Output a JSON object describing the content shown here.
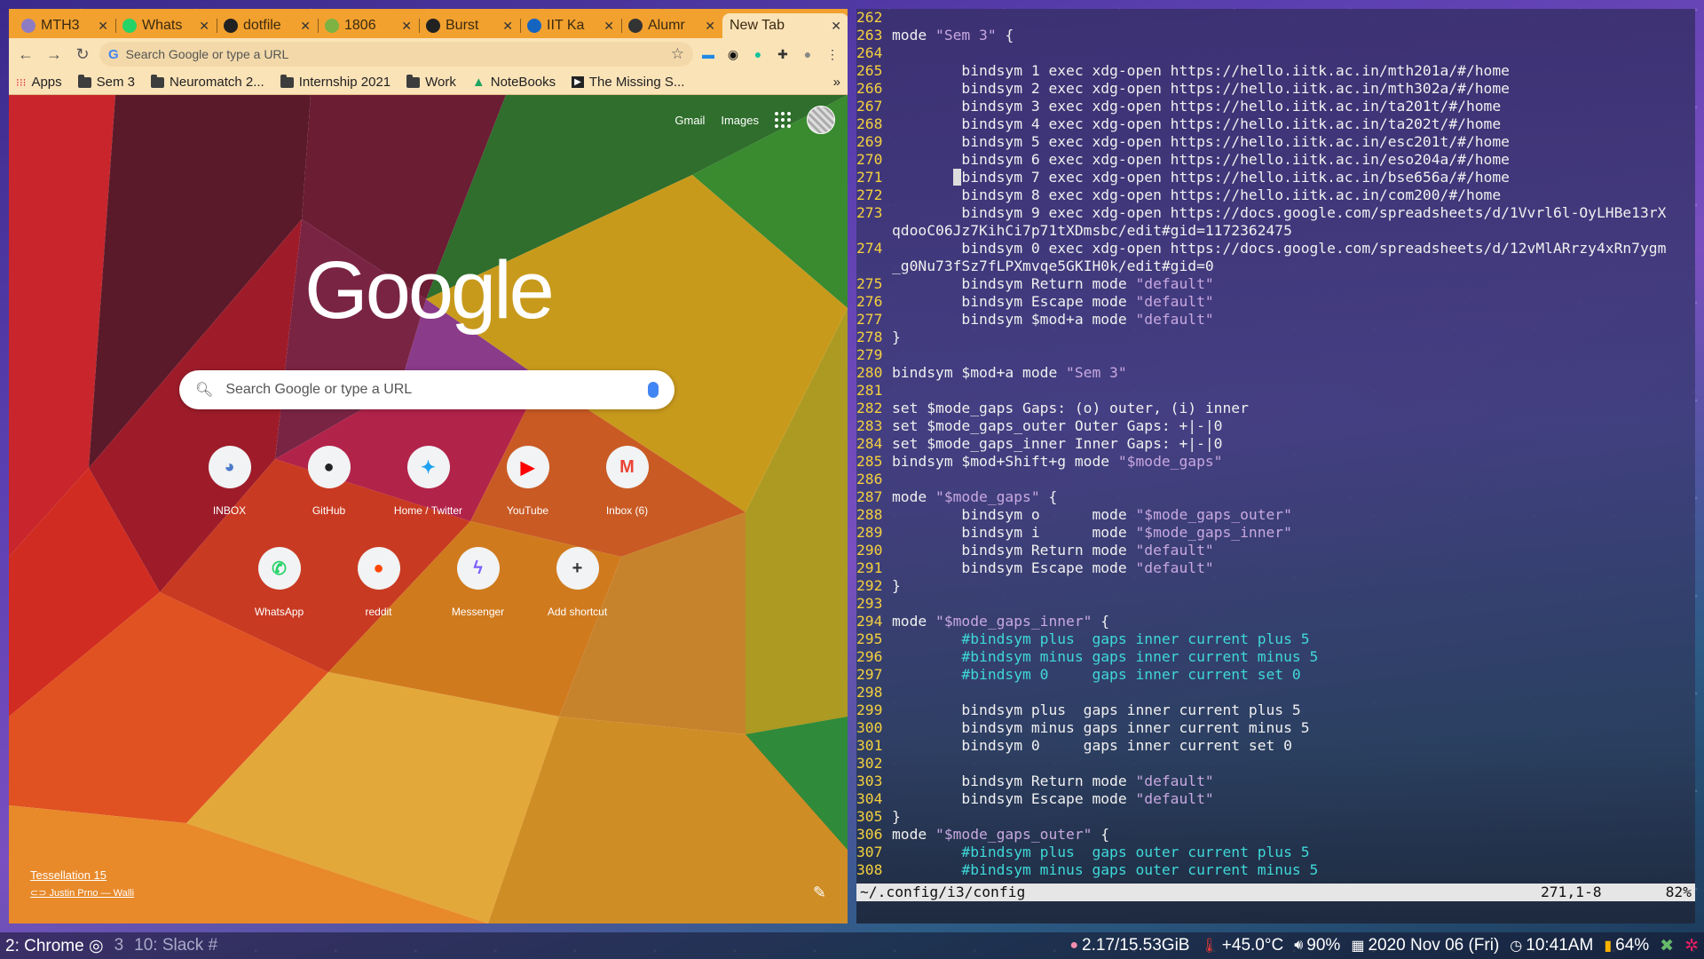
{
  "browser": {
    "tabs": [
      {
        "label": "MTH3",
        "icon": "mth-icon",
        "color": "#8e7cc3"
      },
      {
        "label": "Whats",
        "icon": "whatsapp-icon",
        "color": "#25d366"
      },
      {
        "label": "dotfile",
        "icon": "github-icon",
        "color": "#222222"
      },
      {
        "label": "1806",
        "icon": "smiley-icon",
        "color": "#7cb342"
      },
      {
        "label": "Burst",
        "icon": "burst-icon",
        "color": "#222222"
      },
      {
        "label": "IIT Ka",
        "icon": "iitk-icon",
        "color": "#1565c0"
      },
      {
        "label": "Alumr",
        "icon": "clock-icon",
        "color": "#333333"
      },
      {
        "label": "New Tab",
        "icon": "",
        "color": ""
      }
    ],
    "omnibox_placeholder": "Search Google or type a URL",
    "bookmarks": [
      {
        "label": "Apps",
        "type": "apps"
      },
      {
        "label": "Sem 3",
        "type": "folder"
      },
      {
        "label": "Neuromatch 2...",
        "type": "folder"
      },
      {
        "label": "Internship 2021",
        "type": "folder"
      },
      {
        "label": "Work",
        "type": "folder"
      },
      {
        "label": "NoteBooks",
        "type": "drive"
      },
      {
        "label": "The Missing S...",
        "type": "site"
      }
    ],
    "bookmarks_more": "»"
  },
  "ntp": {
    "gmail": "Gmail",
    "images": "Images",
    "logo": "Google",
    "search_placeholder": "Search Google or type a URL",
    "shortcuts_row1": [
      {
        "label": "INBOX",
        "glyph": "◕",
        "color": "#4a79c9"
      },
      {
        "label": "GitHub",
        "glyph": "●",
        "color": "#222222"
      },
      {
        "label": "Home / Twitter",
        "glyph": "✦",
        "color": "#1da1f2"
      },
      {
        "label": "YouTube",
        "glyph": "▶",
        "color": "#ff0000"
      },
      {
        "label": "Inbox (6)",
        "glyph": "M",
        "color": "#ea4335"
      }
    ],
    "shortcuts_row2": [
      {
        "label": "WhatsApp",
        "glyph": "✆",
        "color": "#25d366"
      },
      {
        "label": "reddit",
        "glyph": "●",
        "color": "#ff4500"
      },
      {
        "label": "Messenger",
        "glyph": "ϟ",
        "color": "#7b5cff"
      },
      {
        "label": "Add shortcut",
        "glyph": "+",
        "color": "#333333"
      }
    ],
    "theme_title": "Tessellation 15",
    "theme_author": "Justin Prno — Walli"
  },
  "vim": {
    "lines": [
      {
        "n": "262",
        "parts": [
          {
            "t": ""
          }
        ]
      },
      {
        "n": "263",
        "parts": [
          {
            "t": "mode "
          },
          {
            "t": "\"Sem 3\"",
            "c": "str"
          },
          {
            "t": " {"
          }
        ]
      },
      {
        "n": "264",
        "parts": [
          {
            "t": ""
          }
        ]
      },
      {
        "n": "265",
        "parts": [
          {
            "t": "        bindsym 1 exec xdg-open https://hello.iitk.ac.in/mth201a/#/home"
          }
        ]
      },
      {
        "n": "266",
        "parts": [
          {
            "t": "        bindsym 2 exec xdg-open https://hello.iitk.ac.in/mth302a/#/home"
          }
        ]
      },
      {
        "n": "267",
        "parts": [
          {
            "t": "        bindsym 3 exec xdg-open https://hello.iitk.ac.in/ta201t/#/home"
          }
        ]
      },
      {
        "n": "268",
        "parts": [
          {
            "t": "        bindsym 4 exec xdg-open https://hello.iitk.ac.in/ta202t/#/home"
          }
        ]
      },
      {
        "n": "269",
        "parts": [
          {
            "t": "        bindsym 5 exec xdg-open https://hello.iitk.ac.in/esc201t/#/home"
          }
        ]
      },
      {
        "n": "270",
        "parts": [
          {
            "t": "        bindsym 6 exec xdg-open https://hello.iitk.ac.in/eso204a/#/home"
          }
        ]
      },
      {
        "n": "271",
        "parts": [
          {
            "t": "       "
          },
          {
            "t": " ",
            "c": "cursor"
          },
          {
            "t": "bindsym 7 exec xdg-open https://hello.iitk.ac.in/bse656a/#/home"
          }
        ]
      },
      {
        "n": "272",
        "parts": [
          {
            "t": "        bindsym 8 exec xdg-open https://hello.iitk.ac.in/com200/#/home"
          }
        ]
      },
      {
        "n": "273",
        "parts": [
          {
            "t": "        bindsym 9 exec xdg-open https://docs.google.com/spreadsheets/d/1Vvrl6l-OyLHBe13rX"
          }
        ]
      },
      {
        "n": "",
        "parts": [
          {
            "t": "qdooC06Jz7KihCi7p71tXDmsbc/edit#gid=1172362475"
          }
        ]
      },
      {
        "n": "274",
        "parts": [
          {
            "t": "        bindsym 0 exec xdg-open https://docs.google.com/spreadsheets/d/12vMlARrzy4xRn7ygm"
          }
        ]
      },
      {
        "n": "",
        "parts": [
          {
            "t": "_g0Nu73fSz7fLPXmvqe5GKIH0k/edit#gid=0"
          }
        ]
      },
      {
        "n": "275",
        "parts": [
          {
            "t": "        bindsym Return mode "
          },
          {
            "t": "\"default\"",
            "c": "str"
          }
        ]
      },
      {
        "n": "276",
        "parts": [
          {
            "t": "        bindsym Escape mode "
          },
          {
            "t": "\"default\"",
            "c": "str"
          }
        ]
      },
      {
        "n": "277",
        "parts": [
          {
            "t": "        bindsym $mod+a mode "
          },
          {
            "t": "\"default\"",
            "c": "str"
          }
        ]
      },
      {
        "n": "278",
        "parts": [
          {
            "t": "}"
          }
        ]
      },
      {
        "n": "279",
        "parts": [
          {
            "t": ""
          }
        ]
      },
      {
        "n": "280",
        "parts": [
          {
            "t": "bindsym $mod+a mode "
          },
          {
            "t": "\"Sem 3\"",
            "c": "str"
          }
        ]
      },
      {
        "n": "281",
        "parts": [
          {
            "t": ""
          }
        ]
      },
      {
        "n": "282",
        "parts": [
          {
            "t": "set $mode_gaps Gaps: (o) outer, (i) inner"
          }
        ]
      },
      {
        "n": "283",
        "parts": [
          {
            "t": "set $mode_gaps_outer Outer Gaps: +|-|0"
          }
        ]
      },
      {
        "n": "284",
        "parts": [
          {
            "t": "set $mode_gaps_inner Inner Gaps: +|-|0"
          }
        ]
      },
      {
        "n": "285",
        "parts": [
          {
            "t": "bindsym $mod+Shift+g mode "
          },
          {
            "t": "\"$mode_gaps\"",
            "c": "str"
          }
        ]
      },
      {
        "n": "286",
        "parts": [
          {
            "t": ""
          }
        ]
      },
      {
        "n": "287",
        "parts": [
          {
            "t": "mode "
          },
          {
            "t": "\"$mode_gaps\"",
            "c": "str"
          },
          {
            "t": " {"
          }
        ]
      },
      {
        "n": "288",
        "parts": [
          {
            "t": "        bindsym o      mode "
          },
          {
            "t": "\"$mode_gaps_outer\"",
            "c": "str"
          }
        ]
      },
      {
        "n": "289",
        "parts": [
          {
            "t": "        bindsym i      mode "
          },
          {
            "t": "\"$mode_gaps_inner\"",
            "c": "str"
          }
        ]
      },
      {
        "n": "290",
        "parts": [
          {
            "t": "        bindsym Return mode "
          },
          {
            "t": "\"default\"",
            "c": "str"
          }
        ]
      },
      {
        "n": "291",
        "parts": [
          {
            "t": "        bindsym Escape mode "
          },
          {
            "t": "\"default\"",
            "c": "str"
          }
        ]
      },
      {
        "n": "292",
        "parts": [
          {
            "t": "}"
          }
        ]
      },
      {
        "n": "293",
        "parts": [
          {
            "t": ""
          }
        ]
      },
      {
        "n": "294",
        "parts": [
          {
            "t": "mode "
          },
          {
            "t": "\"$mode_gaps_inner\"",
            "c": "str"
          },
          {
            "t": " {"
          }
        ]
      },
      {
        "n": "295",
        "parts": [
          {
            "t": "        "
          },
          {
            "t": "#bindsym plus  gaps inner current plus 5",
            "c": "cmt"
          }
        ]
      },
      {
        "n": "296",
        "parts": [
          {
            "t": "        "
          },
          {
            "t": "#bindsym minus gaps inner current minus 5",
            "c": "cmt"
          }
        ]
      },
      {
        "n": "297",
        "parts": [
          {
            "t": "        "
          },
          {
            "t": "#bindsym 0     gaps inner current set 0",
            "c": "cmt"
          }
        ]
      },
      {
        "n": "298",
        "parts": [
          {
            "t": ""
          }
        ]
      },
      {
        "n": "299",
        "parts": [
          {
            "t": "        bindsym plus  gaps inner current plus 5"
          }
        ]
      },
      {
        "n": "300",
        "parts": [
          {
            "t": "        bindsym minus gaps inner current minus 5"
          }
        ]
      },
      {
        "n": "301",
        "parts": [
          {
            "t": "        bindsym 0     gaps inner current set 0"
          }
        ]
      },
      {
        "n": "302",
        "parts": [
          {
            "t": ""
          }
        ]
      },
      {
        "n": "303",
        "parts": [
          {
            "t": "        bindsym Return mode "
          },
          {
            "t": "\"default\"",
            "c": "str"
          }
        ]
      },
      {
        "n": "304",
        "parts": [
          {
            "t": "        bindsym Escape mode "
          },
          {
            "t": "\"default\"",
            "c": "str"
          }
        ]
      },
      {
        "n": "305",
        "parts": [
          {
            "t": "}"
          }
        ]
      },
      {
        "n": "306",
        "parts": [
          {
            "t": "mode "
          },
          {
            "t": "\"$mode_gaps_outer\"",
            "c": "str"
          },
          {
            "t": " {"
          }
        ]
      },
      {
        "n": "307",
        "parts": [
          {
            "t": "        "
          },
          {
            "t": "#bindsym plus  gaps outer current plus 5",
            "c": "cmt"
          }
        ]
      },
      {
        "n": "308",
        "parts": [
          {
            "t": "        "
          },
          {
            "t": "#bindsym minus gaps outer current minus 5",
            "c": "cmt"
          }
        ]
      }
    ],
    "status_file": "~/.config/i3/config",
    "status_pos": "271,1-8",
    "status_pct": "82%"
  },
  "bar": {
    "ws_active": "2: Chrome",
    "ws_3": "3",
    "ws_10": "10: Slack",
    "mem": "2.17/15.53GiB",
    "temp": "+45.0°C",
    "volume": "90%",
    "date": "2020 Nov 06 (Fri)",
    "time": "10:41AM",
    "battery": "64%"
  }
}
